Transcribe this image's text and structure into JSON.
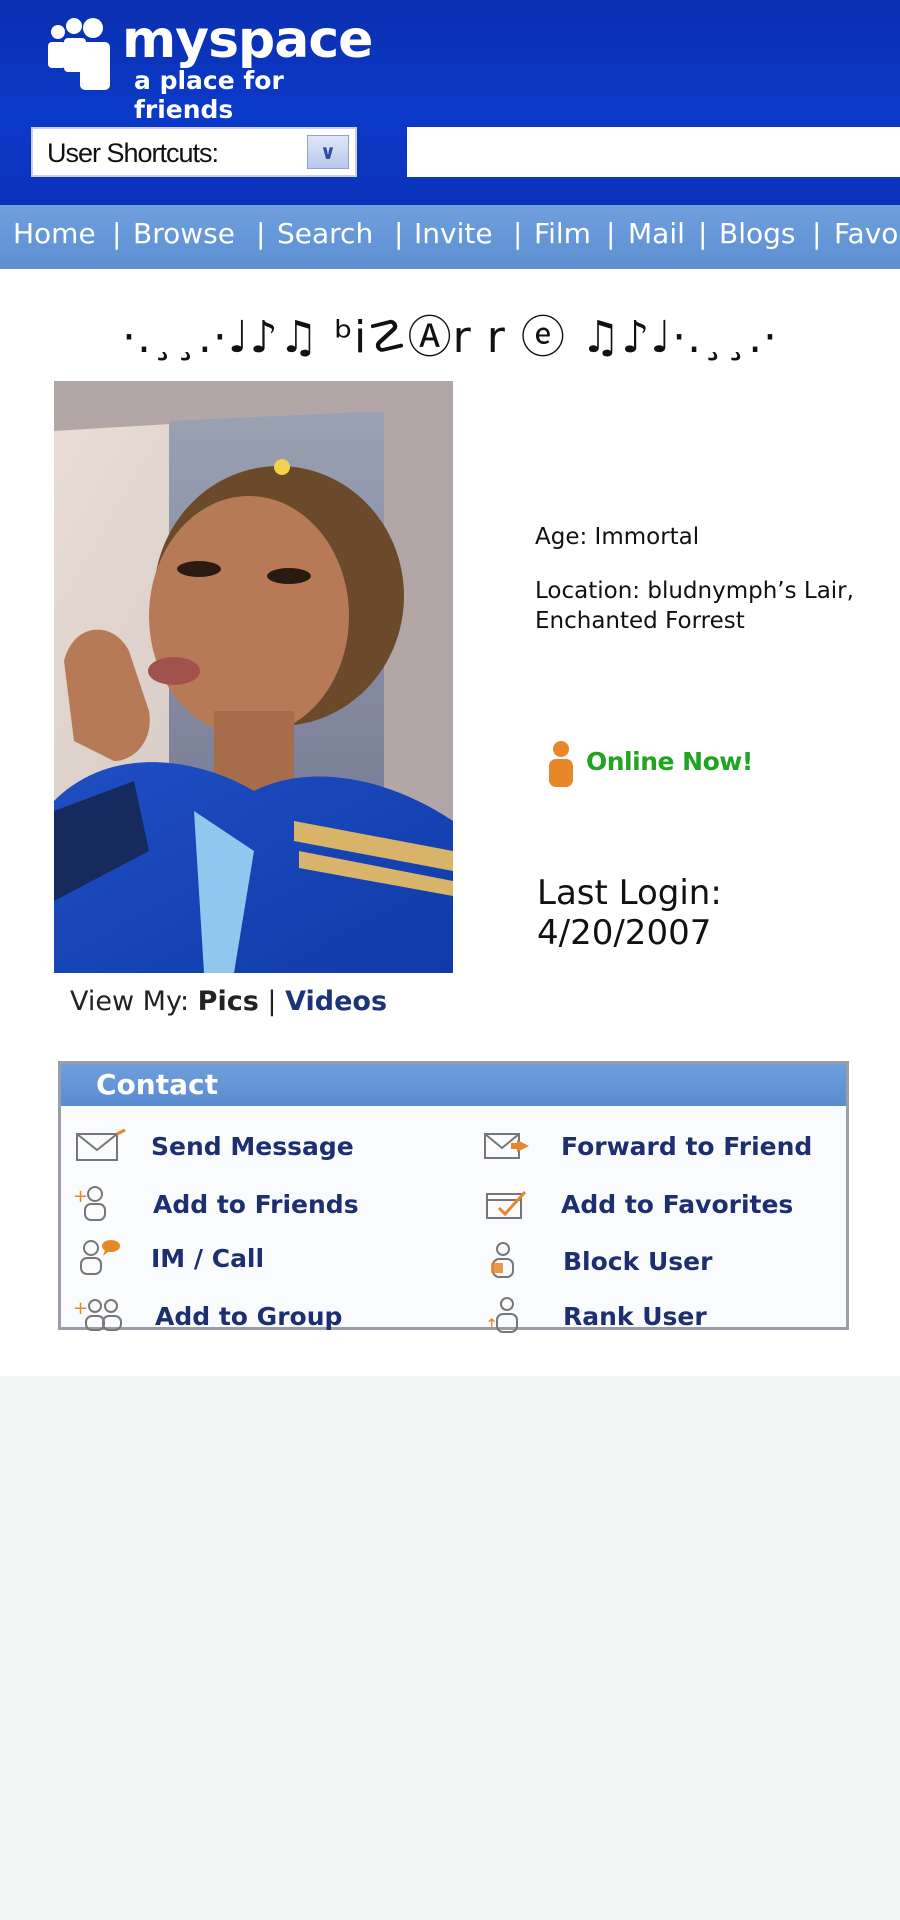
{
  "header": {
    "logo_name": "myspace",
    "logo_tagline": "a place for friends",
    "shortcuts_label": "User Shortcuts:",
    "search_value": ""
  },
  "nav": {
    "items": [
      "Home",
      "Browse",
      "Search",
      "Invite",
      "Film",
      "Mail",
      "Blogs",
      "Favo"
    ],
    "separator": "|"
  },
  "profile": {
    "display_name": "·.¸¸.·♩♪♫ ᵇi☡Ⓐr r ⓔ ♫♪♩·.¸¸.·",
    "age": "Age: Immortal",
    "location": "Location: bludnymph’s Lair, Enchanted Forrest",
    "online_status": "Online Now!",
    "last_login_label": "Last Login:",
    "last_login_date": "4/20/2007",
    "view_my_label": "View My:",
    "view_pics": "Pics",
    "view_sep": "|",
    "view_videos": "Videos"
  },
  "contact": {
    "title": "Contact",
    "actions": [
      {
        "label": "Send Message",
        "icon": "envelope-icon"
      },
      {
        "label": "Forward to Friend",
        "icon": "forward-envelope-icon"
      },
      {
        "label": "Add to Friends",
        "icon": "add-friend-icon"
      },
      {
        "label": "Add to Favorites",
        "icon": "favorites-folder-icon"
      },
      {
        "label": "IM / Call",
        "icon": "im-call-icon"
      },
      {
        "label": "Block User",
        "icon": "block-user-icon"
      },
      {
        "label": "Add to Group",
        "icon": "add-group-icon"
      },
      {
        "label": "Rank User",
        "icon": "rank-user-icon"
      }
    ]
  },
  "colors": {
    "header_blue": "#0b39c8",
    "nav_blue": "#6f9fdc",
    "online_green": "#1fa51f",
    "accent_orange": "#e8862a",
    "link_navy": "#1d2f70"
  }
}
